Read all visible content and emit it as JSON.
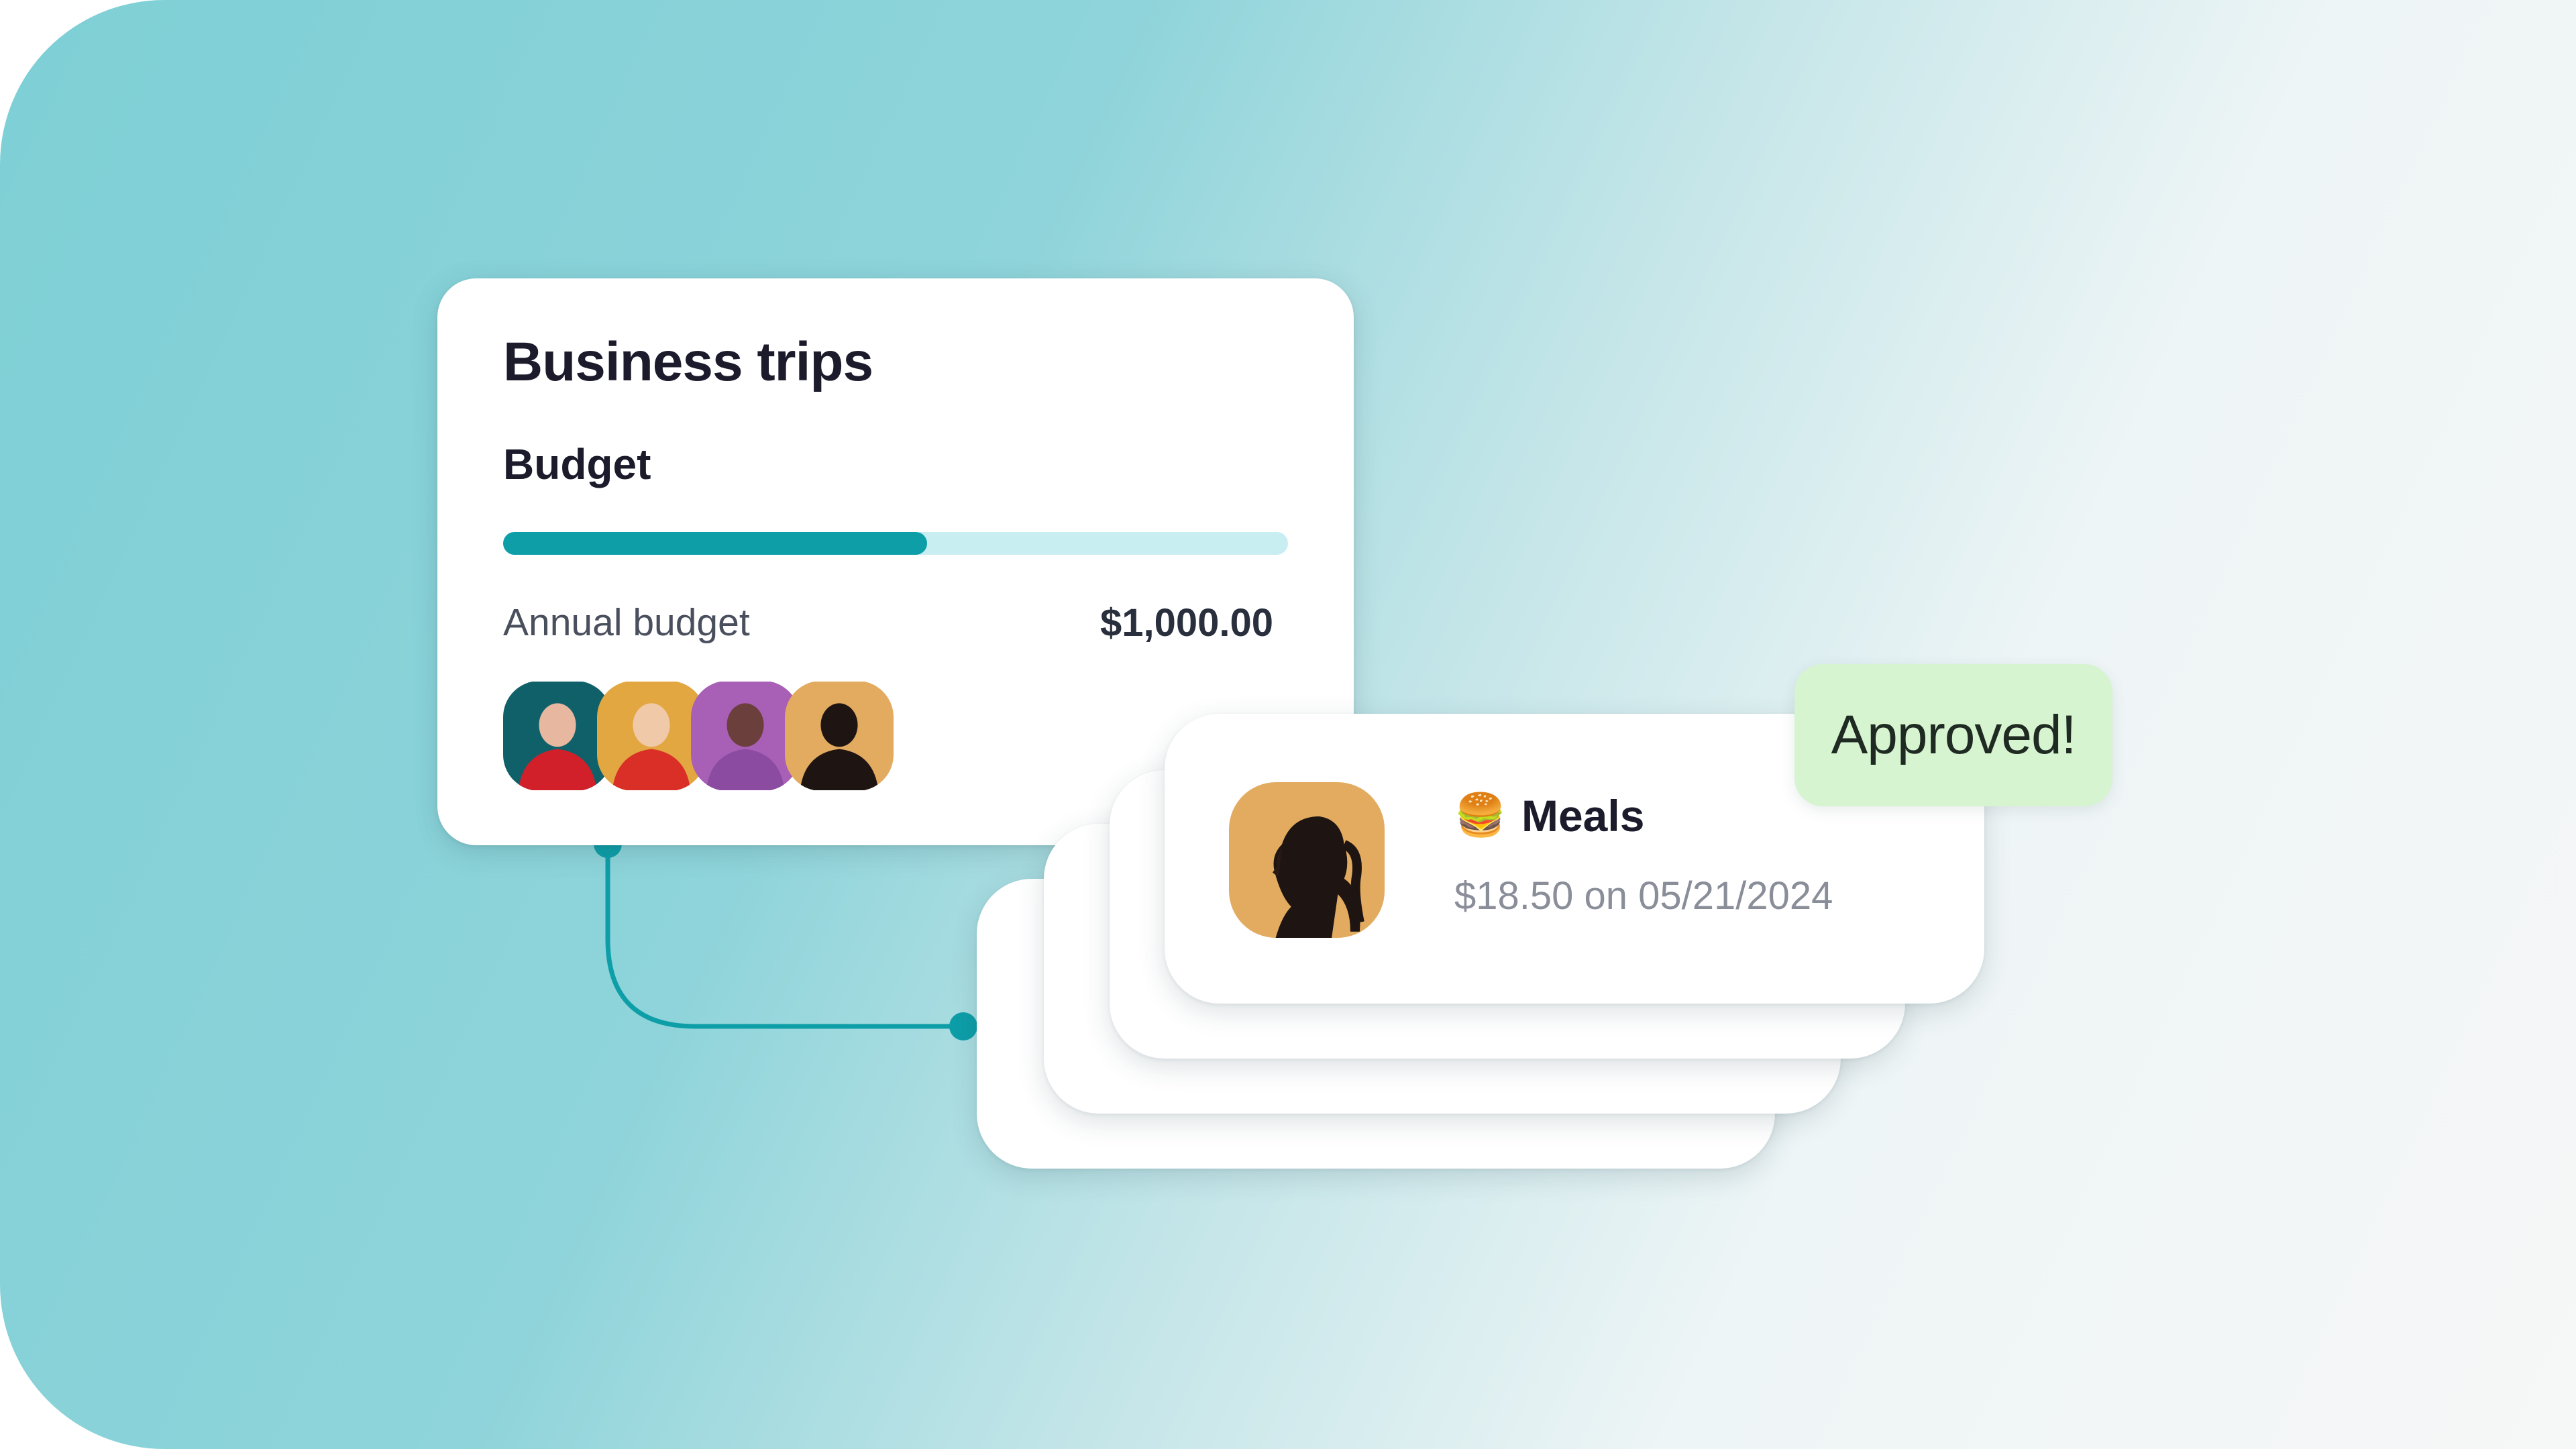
{
  "budget_card": {
    "title": "Business trips",
    "subtitle": "Budget",
    "progress_fraction": 0.54,
    "annual_label": "Annual budget",
    "annual_value": "$1,000.00",
    "avatars": [
      {
        "name": "avatar-1",
        "bg": "#10606a",
        "skin": "#e8b7a0",
        "shirt": "#d2202a"
      },
      {
        "name": "avatar-2",
        "bg": "#e3a742",
        "skin": "#f0c9a8",
        "shirt": "#d92f26"
      },
      {
        "name": "avatar-3",
        "bg": "#a85fb6",
        "skin": "#6b3f3b",
        "shirt": "#8a4ba0"
      },
      {
        "name": "avatar-4",
        "bg": "#e2ab60",
        "skin": "#1e1412",
        "shirt": "#1e1412"
      }
    ]
  },
  "expense": {
    "emoji": "🍔",
    "title": "Meals",
    "subtitle": "$18.50 on 05/21/2024"
  },
  "status": {
    "label": "Approved!"
  },
  "colors": {
    "accent": "#0d9ea8",
    "track": "#c8eef2",
    "approved_bg": "#d6f4d0"
  }
}
